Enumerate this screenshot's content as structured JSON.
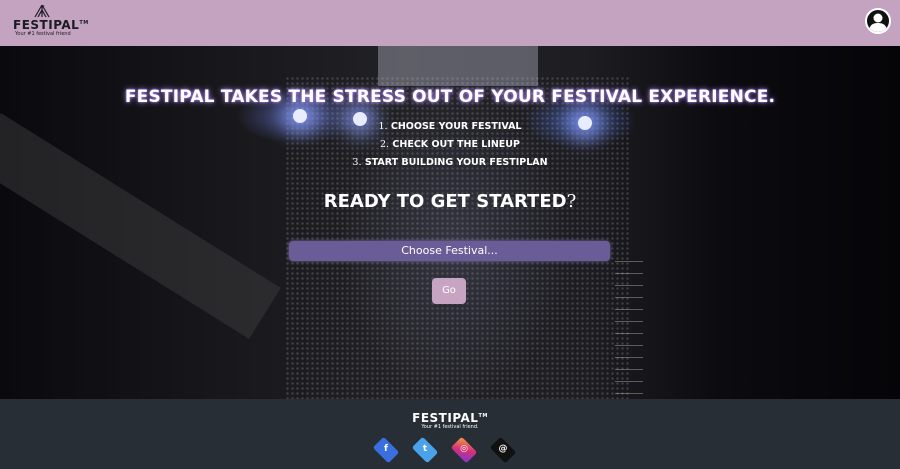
{
  "header": {
    "logo_title": "FESTIPAL",
    "logo_tm": "TM",
    "logo_tagline": "Your #1 festival friend"
  },
  "hero": {
    "headline": "Festipal takes the stress out of your festival experience.",
    "steps": [
      {
        "num": "1.",
        "text": "Choose your festival"
      },
      {
        "num": "2.",
        "text": "Check out the lineup"
      },
      {
        "num": "3.",
        "text": "Start building your FestiPlan"
      }
    ],
    "cta": "Ready to get started",
    "cta_mark": "?",
    "select": {
      "value": "Choose Festival..."
    },
    "go_label": "Go"
  },
  "footer": {
    "title": "FESTIPAL",
    "tm": "TM",
    "tagline": "Your #1 festival friend.",
    "social": [
      {
        "name": "facebook-icon",
        "glyph": "f",
        "color": "#3b6fe0"
      },
      {
        "name": "twitter-icon",
        "glyph": "t",
        "color": "#4aa3ea"
      },
      {
        "name": "instagram-icon",
        "glyph": "◎",
        "color": "#b03ad0"
      },
      {
        "name": "threads-icon",
        "glyph": "@",
        "color": "#111111"
      }
    ]
  },
  "colors": {
    "header_bg": "#c4a3c0",
    "footer_bg": "#282e36",
    "select_bg": "#6a5c96",
    "accent_glow": "#9d7cff"
  }
}
